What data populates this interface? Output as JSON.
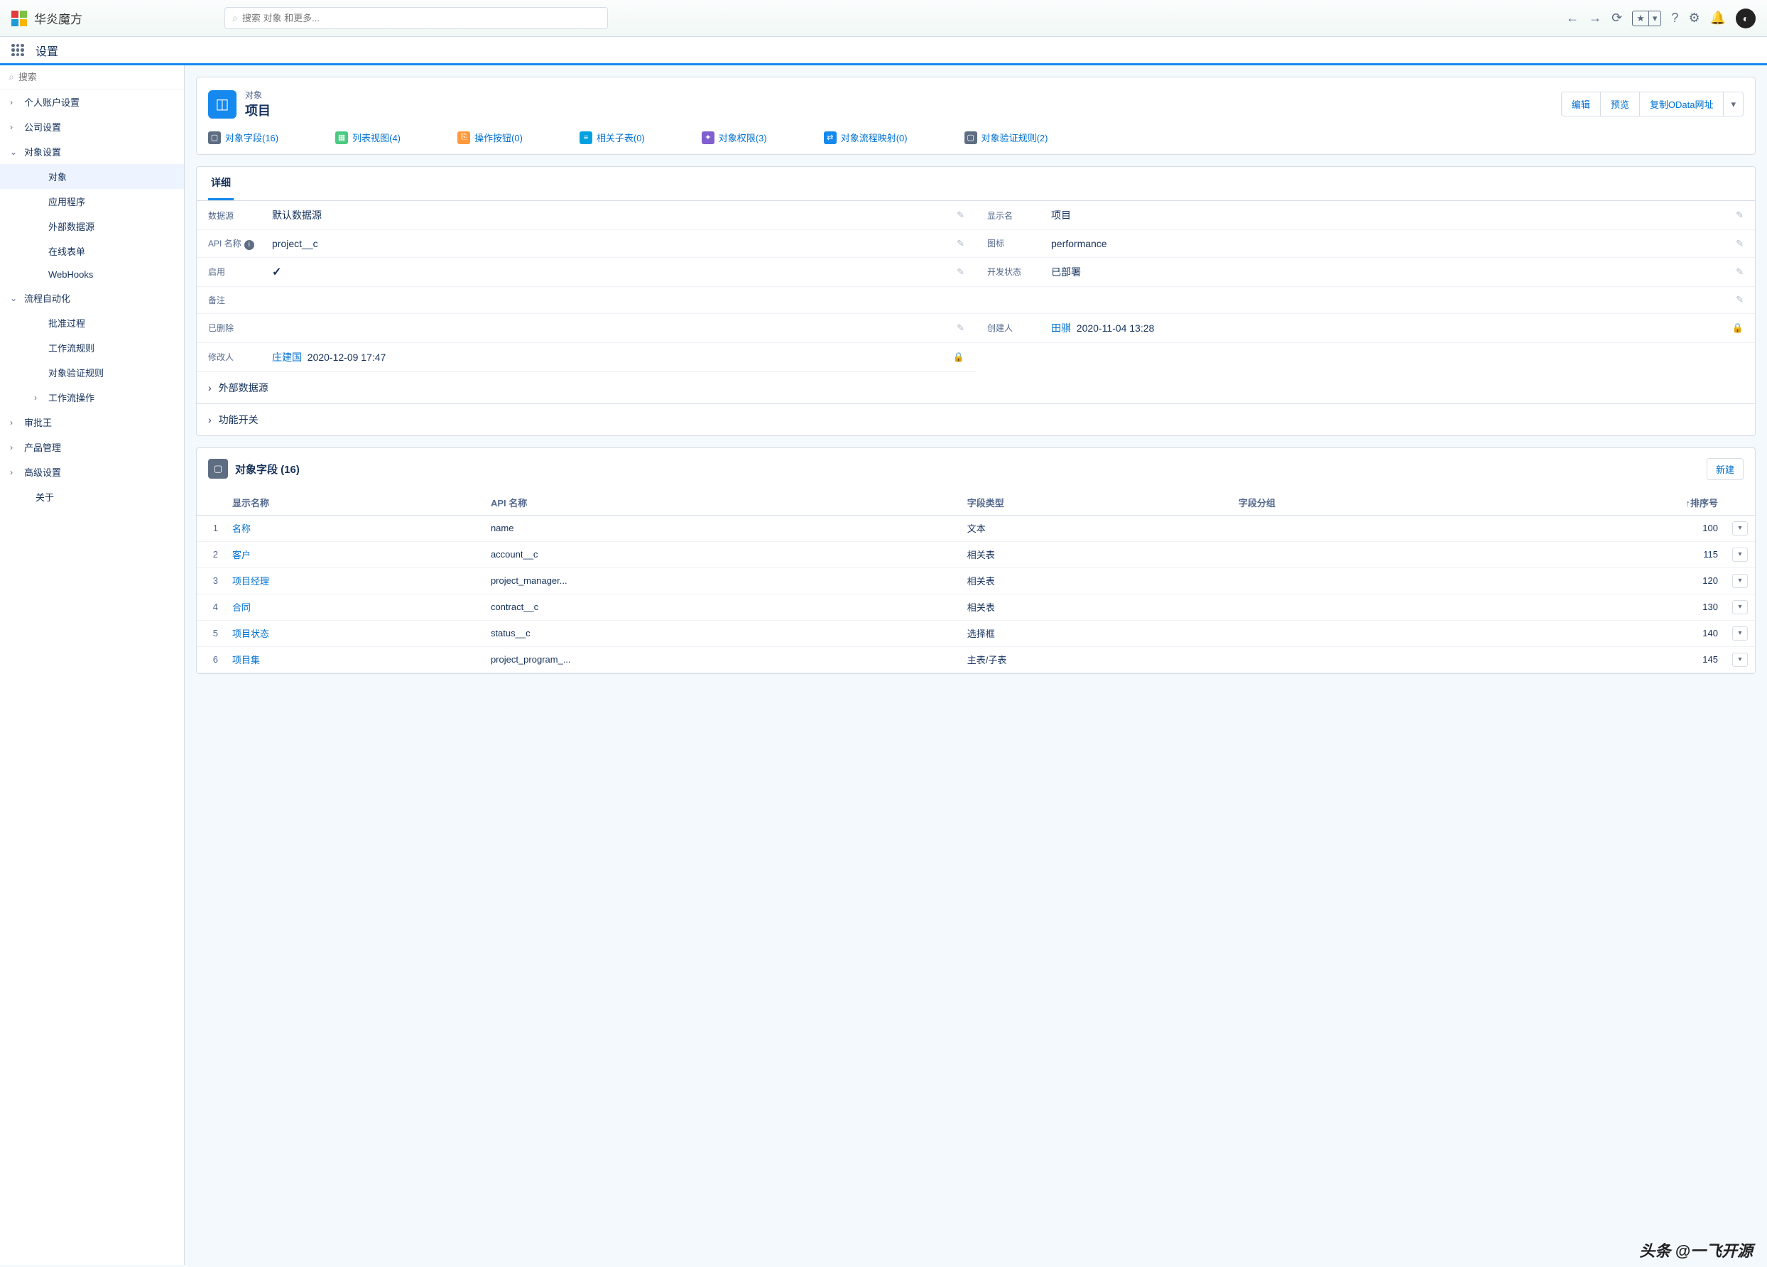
{
  "header": {
    "app_name": "华炎魔方",
    "search_placeholder": "搜索 对象 和更多..."
  },
  "sub_header": {
    "title": "设置"
  },
  "sidebar": {
    "search_placeholder": "搜索",
    "sections": [
      {
        "label": "个人账户设置",
        "expanded": false,
        "level": 1
      },
      {
        "label": "公司设置",
        "expanded": false,
        "level": 1
      },
      {
        "label": "对象设置",
        "expanded": true,
        "level": 1
      },
      {
        "label": "对象",
        "level": 2,
        "active": true
      },
      {
        "label": "应用程序",
        "level": 2
      },
      {
        "label": "外部数据源",
        "level": 2
      },
      {
        "label": "在线表单",
        "level": 2
      },
      {
        "label": "WebHooks",
        "level": 2
      },
      {
        "label": "流程自动化",
        "expanded": true,
        "level": 1
      },
      {
        "label": "批准过程",
        "level": 2
      },
      {
        "label": "工作流规则",
        "level": 2
      },
      {
        "label": "对象验证规则",
        "level": 2
      },
      {
        "label": "工作流操作",
        "level": 2,
        "has_chev": true
      },
      {
        "label": "审批王",
        "expanded": false,
        "level": 1
      },
      {
        "label": "产品管理",
        "expanded": false,
        "level": 1
      },
      {
        "label": "高级设置",
        "expanded": false,
        "level": 1
      },
      {
        "label": "关于",
        "level": 1,
        "leaf": true
      }
    ]
  },
  "object": {
    "breadcrumb": "对象",
    "title": "项目",
    "actions": {
      "edit": "编辑",
      "preview": "预览",
      "copy_odata": "复制OData网址"
    },
    "quick_links": [
      {
        "label": "对象字段(16)",
        "icon_bg": "#5e6d82",
        "icon_glyph": "▢"
      },
      {
        "label": "列表视图(4)",
        "icon_bg": "#4bca81",
        "icon_glyph": "▦"
      },
      {
        "label": "操作按钮(0)",
        "icon_bg": "#ff9a3c",
        "icon_glyph": "⎘"
      },
      {
        "label": "相关子表(0)",
        "icon_bg": "#00a1e0",
        "icon_glyph": "≡"
      },
      {
        "label": "对象权限(3)",
        "icon_bg": "#7f5ecf",
        "icon_glyph": "✦"
      },
      {
        "label": "对象流程映射(0)",
        "icon_bg": "#1589ee",
        "icon_glyph": "⇄"
      },
      {
        "label": "对象验证规则(2)",
        "icon_bg": "#5e6d82",
        "icon_glyph": "▢"
      }
    ]
  },
  "detail": {
    "tab": "详细",
    "rows": {
      "datasource_label": "数据源",
      "datasource_value": "默认数据源",
      "display_label": "显示名",
      "display_value": "项目",
      "api_label": "API 名称",
      "api_value": "project__c",
      "icon_label": "图标",
      "icon_value": "performance",
      "enabled_label": "启用",
      "enabled_value": "✓",
      "dev_label": "开发状态",
      "dev_value": "已部署",
      "remark_label": "备注",
      "remark_value": "",
      "deleted_label": "已删除",
      "deleted_value": "",
      "creator_label": "创建人",
      "creator_name": "田骐",
      "creator_time": "2020-11-04 13:28",
      "modifier_label": "修改人",
      "modifier_name": "庄建国",
      "modifier_time": "2020-12-09 17:47"
    },
    "collapsed": [
      "外部数据源",
      "功能开关"
    ]
  },
  "fields_section": {
    "title": "对象字段 (16)",
    "new_button": "新建",
    "columns": {
      "name": "显示名称",
      "api": "API 名称",
      "type": "字段类型",
      "group": "字段分组",
      "sort": "↑排序号"
    },
    "rows": [
      {
        "n": 1,
        "name": "名称",
        "api": "name",
        "type": "文本",
        "sort": 100
      },
      {
        "n": 2,
        "name": "客户",
        "api": "account__c",
        "type": "相关表",
        "sort": 115
      },
      {
        "n": 3,
        "name": "项目经理",
        "api": "project_manager...",
        "type": "相关表",
        "sort": 120
      },
      {
        "n": 4,
        "name": "合同",
        "api": "contract__c",
        "type": "相关表",
        "sort": 130
      },
      {
        "n": 5,
        "name": "项目状态",
        "api": "status__c",
        "type": "选择框",
        "sort": 140
      },
      {
        "n": 6,
        "name": "项目集",
        "api": "project_program_...",
        "type": "主表/子表",
        "sort": 145
      }
    ]
  },
  "watermark": "头条 @一飞开源"
}
